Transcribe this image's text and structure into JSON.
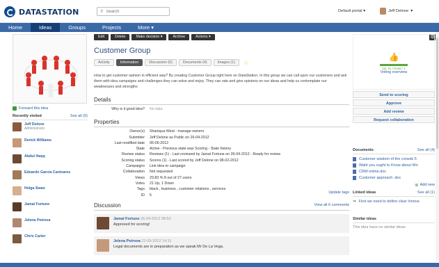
{
  "header": {
    "logo": "DATASTATION",
    "search_placeholder": "Search",
    "portal": "Default portal",
    "user": "Jeff Delone"
  },
  "nav": [
    "Home",
    "Ideas",
    "Groups",
    "Projects",
    "More ▾"
  ],
  "toolbar": [
    "Edit",
    "Delete",
    "Make decision ▾",
    "Archive",
    "Actions ▾"
  ],
  "idea": {
    "title": "Customer Group",
    "tabs": [
      "Activity",
      "Information",
      "Discussion (6)",
      "Documents (4)",
      "Images (1)"
    ],
    "active_tab": "Information",
    "description": "How to get customer opinion in efficient way? By creating Customer Group right here on DataStation. In this group we can call upon our customers and ask them with idea campaigns and challenges they can solve and enjoy. They can rate and give opinions on our ideas and help us contemplate our weaknesses and strengths"
  },
  "details": {
    "heading": "Details",
    "label": "Why is it good idea?",
    "value": "No data"
  },
  "properties": {
    "heading": "Properties",
    "rows": [
      {
        "label": "Owner(s)",
        "value": "Shaniqua West - manage owners"
      },
      {
        "label": "Submitter",
        "value": "Jeff Delone as Public on 26-04-2012"
      },
      {
        "label": "Last modified date",
        "value": "06-06-2012"
      },
      {
        "label": "State",
        "value": "Active - Previous state was Scoring - State history"
      },
      {
        "label": "Review status",
        "value": "Reviews (1) - Last reviewed by Jamal Fortune on 26-04-2012 - Ready for review"
      },
      {
        "label": "Scoring status",
        "value": "Scores (1) - Last scored by Jeff Delone on 08-02-2012"
      },
      {
        "label": "Campaigns",
        "value": "Link idea to campaign"
      },
      {
        "label": "Collaboration",
        "value": "Not requested"
      },
      {
        "label": "Views",
        "value": "29.83 % 8 out of 27 users"
      },
      {
        "label": "Votes",
        "value": "21 Up, 1 Down"
      },
      {
        "label": "Tags",
        "value": "black , business , customer relations , services"
      },
      {
        "label": "ID",
        "value": "5"
      }
    ],
    "update_tags": "Update tags"
  },
  "discussion": {
    "heading": "Discussion",
    "view_all": "View all 6 comments",
    "comments": [
      {
        "author": "Jamal Fortune",
        "date": "26-04-2012 08:53",
        "text": "Approved for scoring!"
      },
      {
        "author": "Jelena Petrova",
        "date": "21-09-2012 14:11",
        "text": "Legal documents are in preparation as we speak Mr De La Vega."
      }
    ]
  },
  "left": {
    "forward": "Forward this idea",
    "recent_heading": "Recently visited",
    "see_all": "See all (6)",
    "recent": [
      {
        "name": "Jeff Delone",
        "sub": "Administrator"
      },
      {
        "name": "Derick Williams",
        "sub": ""
      },
      {
        "name": "Abdul Haqq",
        "sub": ""
      },
      {
        "name": "Eduardo Garcia Canisares",
        "sub": ""
      },
      {
        "name": "Helga Swan",
        "sub": ""
      },
      {
        "name": "Jamal Fortune",
        "sub": ""
      },
      {
        "name": "Jelena Petrova",
        "sub": ""
      },
      {
        "name": "Chris Carter",
        "sub": ""
      }
    ]
  },
  "right": {
    "vote_count": "Up: 21 / Down: 1",
    "voting_overview": "Voting overview",
    "actions": [
      "Send to scoring",
      "Approve",
      "Add review",
      "Request collaboration"
    ],
    "docs_heading": "Documents",
    "docs_see_all": "See all (4)",
    "docs": [
      "Customer wisdom of the crowds 5",
      "Waht you ought to Know about Wo",
      "CRM online.doc",
      "Customer approach .doc"
    ],
    "add_new": "Add new",
    "linked_heading": "Linked ideas",
    "linked_see_all": "See all (1)",
    "linked": [
      "First we need to define clear Innova"
    ],
    "similar_heading": "Similar ideas",
    "similar_text": "This idea have no similar ideas."
  },
  "colors": {
    "nav": "#3a69a8",
    "nav_active": "#163e78",
    "link": "#2b5e9e"
  }
}
